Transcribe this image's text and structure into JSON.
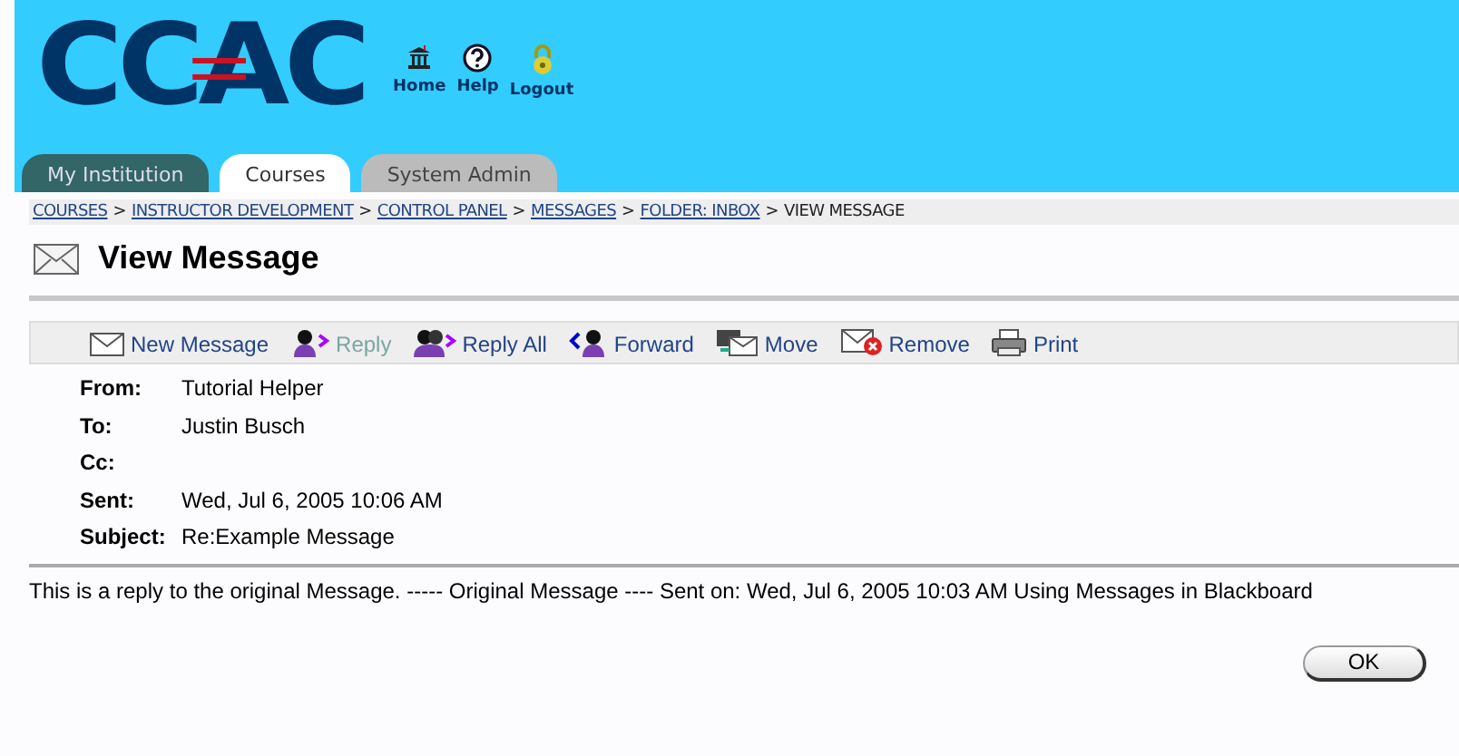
{
  "header": {
    "logo": "CCAC",
    "links": [
      {
        "label": "Home",
        "kind": "home"
      },
      {
        "label": "Help",
        "kind": "help"
      },
      {
        "label": "Logout",
        "kind": "logout"
      }
    ]
  },
  "tabs": [
    {
      "label": "My Institution",
      "selected": false,
      "kind": "dark"
    },
    {
      "label": "Courses",
      "selected": true,
      "kind": "light"
    },
    {
      "label": "System Admin",
      "selected": false,
      "kind": "grey"
    }
  ],
  "breadcrumb": [
    {
      "label": "COURSES",
      "link": true
    },
    {
      "label": "INSTRUCTOR DEVELOPMENT",
      "link": true
    },
    {
      "label": "CONTROL PANEL",
      "link": true
    },
    {
      "label": "MESSAGES",
      "link": true
    },
    {
      "label": "FOLDER: INBOX",
      "link": true
    },
    {
      "label": "VIEW MESSAGE",
      "link": false
    }
  ],
  "breadcrumb_separator": ">",
  "page_title": "View Message",
  "toolbar": [
    {
      "label": "New Message",
      "kind": "new",
      "disabled": false
    },
    {
      "label": "Reply",
      "kind": "reply",
      "disabled": true
    },
    {
      "label": "Reply All",
      "kind": "replyall",
      "disabled": false
    },
    {
      "label": "Forward",
      "kind": "forward",
      "disabled": false
    },
    {
      "label": "Move",
      "kind": "move",
      "disabled": false
    },
    {
      "label": "Remove",
      "kind": "remove",
      "disabled": false
    },
    {
      "label": "Print",
      "kind": "print",
      "disabled": false
    }
  ],
  "fields": [
    {
      "label": "From:",
      "value": "Tutorial Helper"
    },
    {
      "label": "To:",
      "value": "Justin Busch"
    },
    {
      "label": "Cc:"
    },
    {
      "label": "Sent:",
      "value": "Wed, Jul 6, 2005 10:06 AM"
    },
    {
      "label": "Subject:",
      "value": "Re:Example Message"
    }
  ],
  "body": "This is a reply to the original Message. ----- Original Message ---- Sent on: Wed, Jul 6, 2005 10:03 AM Using Messages in Blackboard",
  "ok_button": "OK"
}
